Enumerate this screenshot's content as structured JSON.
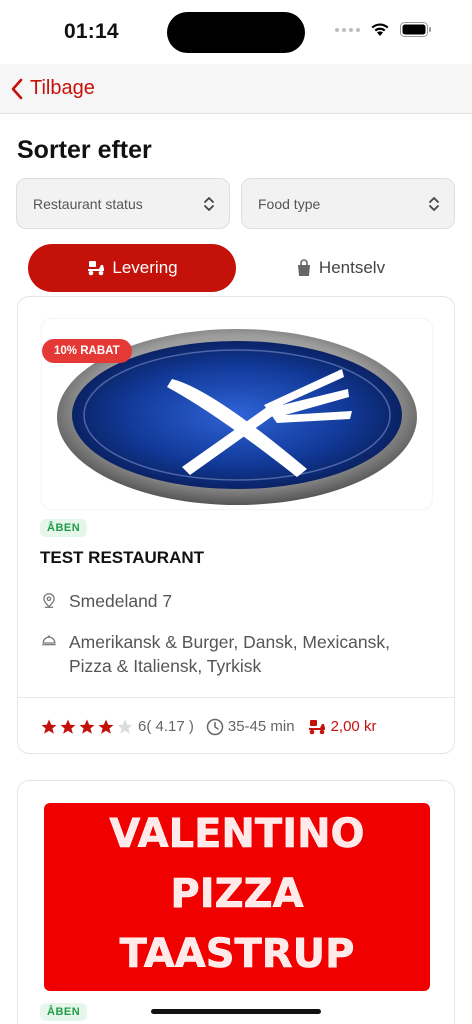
{
  "status_bar": {
    "time": "01:14"
  },
  "nav": {
    "back_label": "Tilbage"
  },
  "page": {
    "title": "Sorter efter"
  },
  "filters": {
    "status_select": "Restaurant status",
    "food_select": "Food type"
  },
  "tabs": [
    {
      "label": "Levering",
      "icon": "delivery-scooter-icon",
      "active": true
    },
    {
      "label": "Hentselv",
      "icon": "shopping-bag-icon",
      "active": false
    }
  ],
  "restaurants": [
    {
      "name": "TEST RESTAURANT",
      "discount": "10% RABAT",
      "status": "ÅBEN",
      "address": "Smedeland 7",
      "cuisine": "Amerikansk & Burger, Dansk, Mexicansk, Pizza & Italiensk, Tyrkisk",
      "rating": 4.17,
      "rating_text": "6( 4.17 )",
      "delivery_time": "35-45 min",
      "delivery_fee": "2,00 kr",
      "logo": "fork-knife-logo"
    },
    {
      "status": "ÅBEN",
      "logo_lines": [
        "VALENTINO",
        "PIZZA",
        "TAASTRUP"
      ]
    }
  ],
  "colors": {
    "accent": "#c4120b",
    "open_green": "#1e9e45",
    "discount_red": "#e53935"
  }
}
